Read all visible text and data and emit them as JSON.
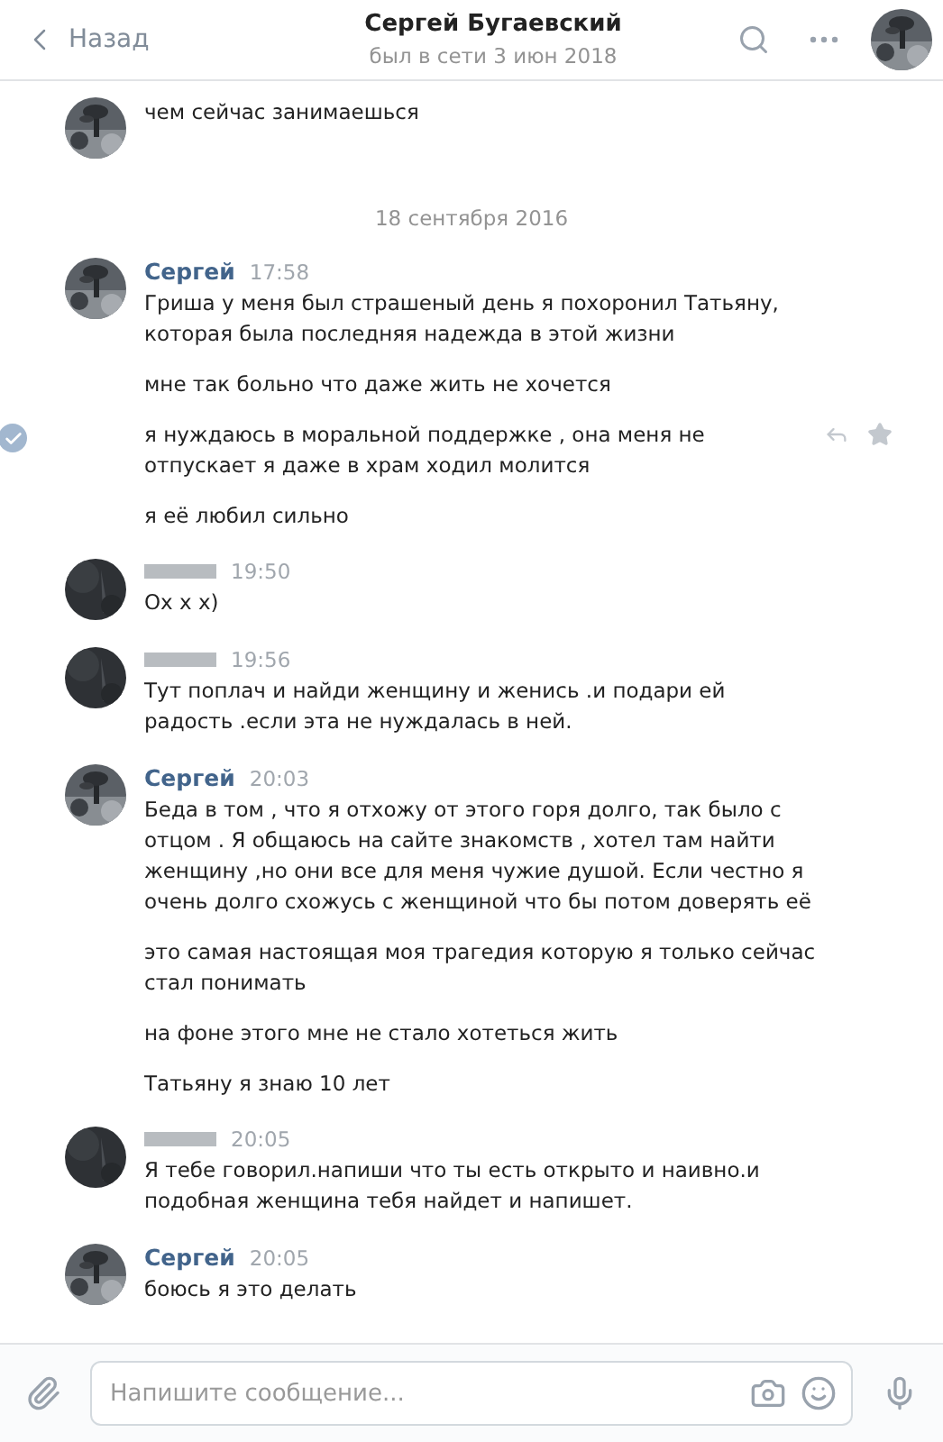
{
  "header": {
    "back": "Назад",
    "title": "Сергей Бугаевский",
    "status": "был в сети 3 июн 2018"
  },
  "feed": [
    {
      "kind": "group",
      "name_hidden": false,
      "paragraphs": [
        {
          "text": "чем сейчас занимаешься",
          "selected": false
        }
      ]
    },
    {
      "kind": "date",
      "text": "18 сентября 2016"
    },
    {
      "kind": "group",
      "author": "Сергей",
      "time": "17:58",
      "name_hidden": false,
      "paragraphs": [
        {
          "text": "Гриша у меня был страшеный день я похоронил Татьяну, которая была последняя надежда в этой жизни",
          "selected": false
        },
        {
          "text": "мне так больно что даже жить не хочется",
          "selected": false
        },
        {
          "text": "я нуждаюсь в моральной поддержке , она меня не отпускает я даже в храм ходил молится",
          "selected": true
        },
        {
          "text": "я её любил сильно",
          "selected": false
        }
      ]
    },
    {
      "kind": "group",
      "time": "19:50",
      "name_hidden": true,
      "paragraphs": [
        {
          "text": "Ох х х)",
          "selected": false
        }
      ]
    },
    {
      "kind": "group",
      "time": "19:56",
      "name_hidden": true,
      "paragraphs": [
        {
          "text": "Тут поплач и найди женщину и женись .и подари ей радость .если эта не нуждалась в ней.",
          "selected": false
        }
      ]
    },
    {
      "kind": "group",
      "author": "Сергей",
      "time": "20:03",
      "name_hidden": false,
      "paragraphs": [
        {
          "text": "Беда в том , что я отхожу от этого горя долго, так было с отцом . Я общаюсь на сайте знакомств , хотел там найти женщину ,но они все для меня чужие душой. Если честно я очень долго схожусь с женщиной что бы потом доверять её",
          "selected": false
        },
        {
          "text": "это самая настоящая моя трагедия которую я только сейчас стал понимать",
          "selected": false
        },
        {
          "text": "на фоне этого мне не стало хотеться жить",
          "selected": false
        },
        {
          "text": "Татьяну я знаю 10 лет",
          "selected": false
        }
      ]
    },
    {
      "kind": "group",
      "time": "20:05",
      "name_hidden": true,
      "paragraphs": [
        {
          "text": "Я тебе говорил.напиши что ты есть открыто и наивно.и подобная женщина тебя найдет и напишет.",
          "selected": false
        }
      ]
    },
    {
      "kind": "group",
      "author": "Сергей",
      "time": "20:05",
      "name_hidden": false,
      "paragraphs": [
        {
          "text": "боюсь я это делать",
          "selected": false
        }
      ]
    }
  ],
  "composer": {
    "placeholder": "Напишите сообщение..."
  }
}
